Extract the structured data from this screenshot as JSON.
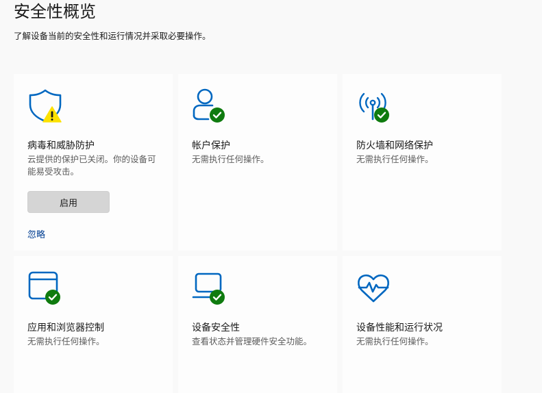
{
  "header": {
    "title": "安全性概览",
    "subtitle": "了解设备当前的安全性和运行情况并采取必要操作。"
  },
  "colors": {
    "accent": "#0067c0",
    "ok_badge": "#0f7b0f",
    "warning_badge": "#fce100",
    "link": "#003e92"
  },
  "cards": [
    {
      "icon": "shield-icon",
      "status": "warning",
      "title": "病毒和威胁防护",
      "description": "云提供的保护已关闭。你的设备可能易受攻击。",
      "action_label": "启用",
      "dismiss_label": "忽略"
    },
    {
      "icon": "person-icon",
      "status": "ok",
      "title": "帐户保护",
      "description": "无需执行任何操作。"
    },
    {
      "icon": "antenna-icon",
      "status": "ok",
      "title": "防火墙和网络保护",
      "description": "无需执行任何操作。"
    },
    {
      "icon": "app-window-icon",
      "status": "ok",
      "title": "应用和浏览器控制",
      "description": "无需执行任何操作。"
    },
    {
      "icon": "laptop-icon",
      "status": "ok",
      "title": "设备安全性",
      "description": "查看状态并管理硬件安全功能。"
    },
    {
      "icon": "heart-pulse-icon",
      "status": "ok",
      "title": "设备性能和运行状况",
      "description": "无需执行任何操作。"
    }
  ]
}
